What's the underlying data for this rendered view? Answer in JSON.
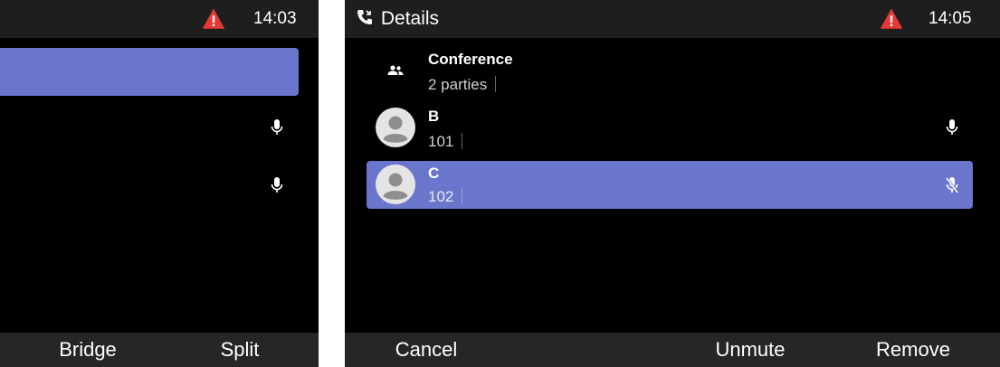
{
  "left_screen": {
    "status": {
      "time": "14:03",
      "warning_icon": "warning-icon"
    },
    "rows": [
      {
        "icon": "microphone-icon"
      },
      {
        "icon": "microphone-icon"
      }
    ],
    "softkeys": {
      "bridge": "Bridge",
      "split": "Split"
    }
  },
  "right_screen": {
    "status": {
      "title": "Details",
      "title_icon": "call-icon",
      "time": "14:05",
      "warning_icon": "warning-icon"
    },
    "conference": {
      "title": "Conference",
      "subtitle": "2 parties",
      "icon": "group-icon"
    },
    "parties": [
      {
        "name": "B",
        "number": "101",
        "icon": "microphone-icon",
        "muted": false,
        "selected": false
      },
      {
        "name": "C",
        "number": "102",
        "icon": "microphone-off-icon",
        "muted": true,
        "selected": true
      }
    ],
    "softkeys": {
      "cancel": "Cancel",
      "unmute": "Unmute",
      "remove": "Remove"
    }
  },
  "colors": {
    "selection": "#6a76cc",
    "warning": "#e53935",
    "statusbar": "#1e1e1e",
    "softkey_bar": "#262626",
    "background": "#000000"
  }
}
